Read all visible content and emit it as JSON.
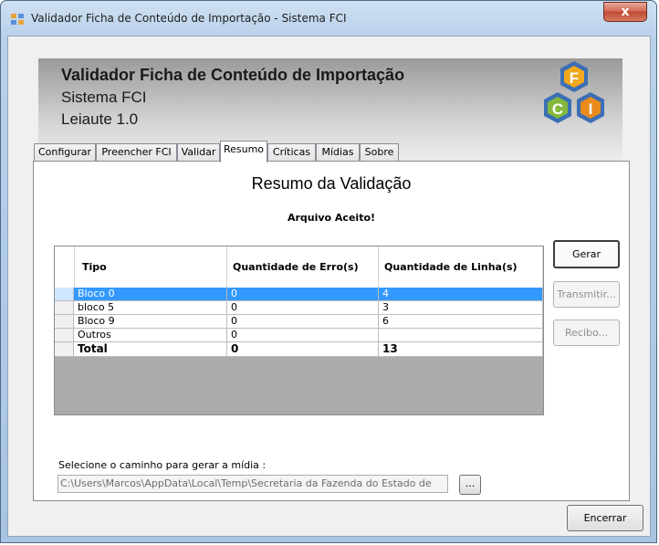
{
  "window": {
    "title": "Validador Ficha de Conteúdo de Importação - Sistema FCI",
    "close_label": "x"
  },
  "header": {
    "title": "Validador Ficha de Conteúdo de Importação",
    "subtitle": "Sistema FCI",
    "version": "Leiaute 1.0",
    "logo_letters": [
      "F",
      "C",
      "I"
    ]
  },
  "tabs": [
    {
      "label": "Configurar"
    },
    {
      "label": "Preencher FCI"
    },
    {
      "label": "Validar"
    },
    {
      "label": "Resumo"
    },
    {
      "label": "Críticas"
    },
    {
      "label": "Mídias"
    },
    {
      "label": "Sobre"
    }
  ],
  "active_tab": "Resumo",
  "resumo": {
    "title": "Resumo da Validação",
    "status": "Arquivo Aceito!",
    "columns": [
      "Tipo",
      "Quantidade de Erro(s)",
      "Quantidade de Linha(s)"
    ],
    "rows": [
      {
        "tipo": "Bloco 0",
        "erros": "0",
        "linhas": "4",
        "selected": true
      },
      {
        "tipo": "bloco 5",
        "erros": "0",
        "linhas": "3"
      },
      {
        "tipo": "Bloco 9",
        "erros": "0",
        "linhas": "6"
      },
      {
        "tipo": "Outros",
        "erros": "0",
        "linhas": ""
      }
    ],
    "total": {
      "tipo": "Total",
      "erros": "0",
      "linhas": "13"
    }
  },
  "buttons": {
    "gerar": "Gerar",
    "transmitir": "Transmitir...",
    "recibo": "Recibo...",
    "browse": "...",
    "encerrar": "Encerrar"
  },
  "path": {
    "label": "Selecione o caminho para gerar a mídia :",
    "value": "C:\\Users\\Marcos\\AppData\\Local\\Temp\\Secretaria da Fazenda do Estado de"
  },
  "colors": {
    "selection": "#3399ff",
    "logo_f": "#f2a81d",
    "logo_c": "#84b93d",
    "logo_i": "#e88a1c",
    "hex_blue": "#3b6fb5"
  }
}
